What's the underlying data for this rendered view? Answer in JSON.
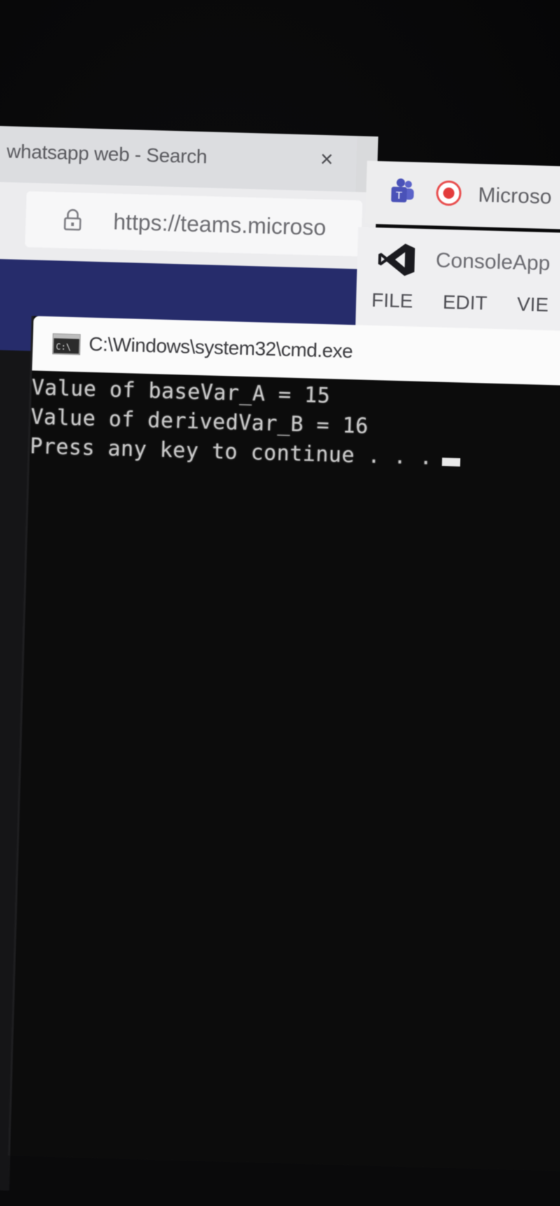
{
  "browser": {
    "tab_title": "whatsapp web - Search",
    "close_glyph": "×",
    "address_url": "https://teams.microso"
  },
  "right_tabbar": {
    "tab_title": "Microso",
    "icons": [
      "teams-icon",
      "record-icon"
    ]
  },
  "visual_studio": {
    "title": "ConsoleApp",
    "menu": [
      "FILE",
      "EDIT",
      "VIE"
    ]
  },
  "cmd": {
    "title": "C:\\Windows\\system32\\cmd.exe",
    "lines": [
      "Value of baseVar_A = 15",
      "Value of derivedVar_B = 16",
      "Press any key to continue . . ."
    ]
  },
  "colors": {
    "console_bg": "#0c0c0c",
    "console_text": "#c8c8c8",
    "teams_blue": "#262c6b",
    "record_red": "#e33c3c"
  }
}
